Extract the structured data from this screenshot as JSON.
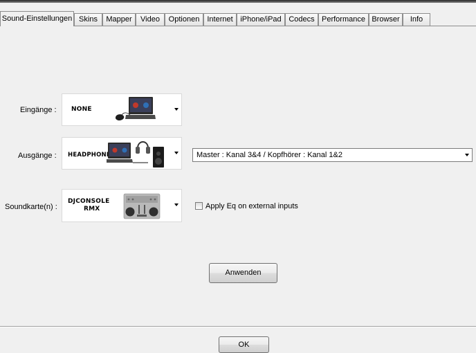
{
  "tabs": [
    {
      "label": "Sound-Einstellungen",
      "active": true
    },
    {
      "label": "Skins"
    },
    {
      "label": "Mapper"
    },
    {
      "label": "Video"
    },
    {
      "label": "Optionen"
    },
    {
      "label": "Internet"
    },
    {
      "label": "iPhone/iPad"
    },
    {
      "label": "Codecs"
    },
    {
      "label": "Performance"
    },
    {
      "label": "Browser"
    },
    {
      "label": "Info"
    }
  ],
  "inputs": {
    "label": "Eingänge :",
    "device": "NONE"
  },
  "outputs": {
    "label": "Ausgänge :",
    "device": "HEADPHONES",
    "routing": "Master : Kanal 3&4 / Kopfhörer : Kanal 1&2"
  },
  "soundcard": {
    "label": "Soundkarte(n) :",
    "device_line1": "DJCONSOLE",
    "device_line2": "RMX",
    "eq_label": "Apply Eq on external inputs",
    "eq_checked": false
  },
  "apply_button": "Anwenden",
  "ok_button": "OK",
  "icons": {
    "inputs": "laptop-with-mouse-icon",
    "outputs": "laptop-headphones-speaker-icon",
    "soundcard": "dj-controller-icon"
  }
}
